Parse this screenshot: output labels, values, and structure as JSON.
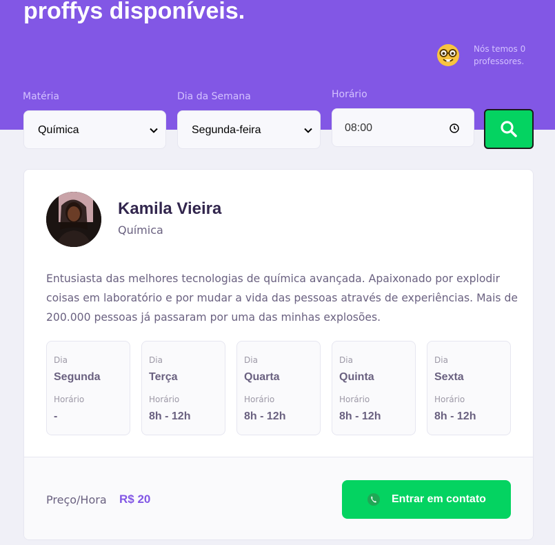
{
  "hero": {
    "title": "proffys disponíveis.",
    "teachers_count": "Nós temos 0 professores.",
    "emoji_icon": "nerd-face-icon"
  },
  "filters": {
    "subject_label": "Matéria",
    "subject_value": "Química",
    "weekday_label": "Dia da Semana",
    "weekday_value": "Segunda-feira",
    "time_label": "Horário",
    "time_value": "08:00",
    "search_icon": "search-icon"
  },
  "teacher": {
    "name": "Kamila Vieira",
    "subject": "Química",
    "bio": "Entusiasta das melhores tecnologias de química avançada. Apaixonado por explodir coisas em laboratório e por mudar a vida das pessoas através de experiências. Mais de 200.000 pessoas já passaram por uma das minhas explosões.",
    "schedule": [
      {
        "day_label": "Dia",
        "day": "Segunda",
        "time_label": "Horário",
        "time": "-"
      },
      {
        "day_label": "Dia",
        "day": "Terça",
        "time_label": "Horário",
        "time": "8h - 12h"
      },
      {
        "day_label": "Dia",
        "day": "Quarta",
        "time_label": "Horário",
        "time": "8h - 12h"
      },
      {
        "day_label": "Dia",
        "day": "Quinta",
        "time_label": "Horário",
        "time": "8h - 12h"
      },
      {
        "day_label": "Dia",
        "day": "Sexta",
        "time_label": "Horário",
        "time": "8h - 12h"
      }
    ],
    "price_label": "Preço/Hora",
    "price_value": "R$ 20",
    "contact_label": "Entrar em contato"
  },
  "colors": {
    "primary": "#8257e5",
    "secondary": "#04d361",
    "title_text": "#32264d",
    "body_text": "#6a6180"
  }
}
